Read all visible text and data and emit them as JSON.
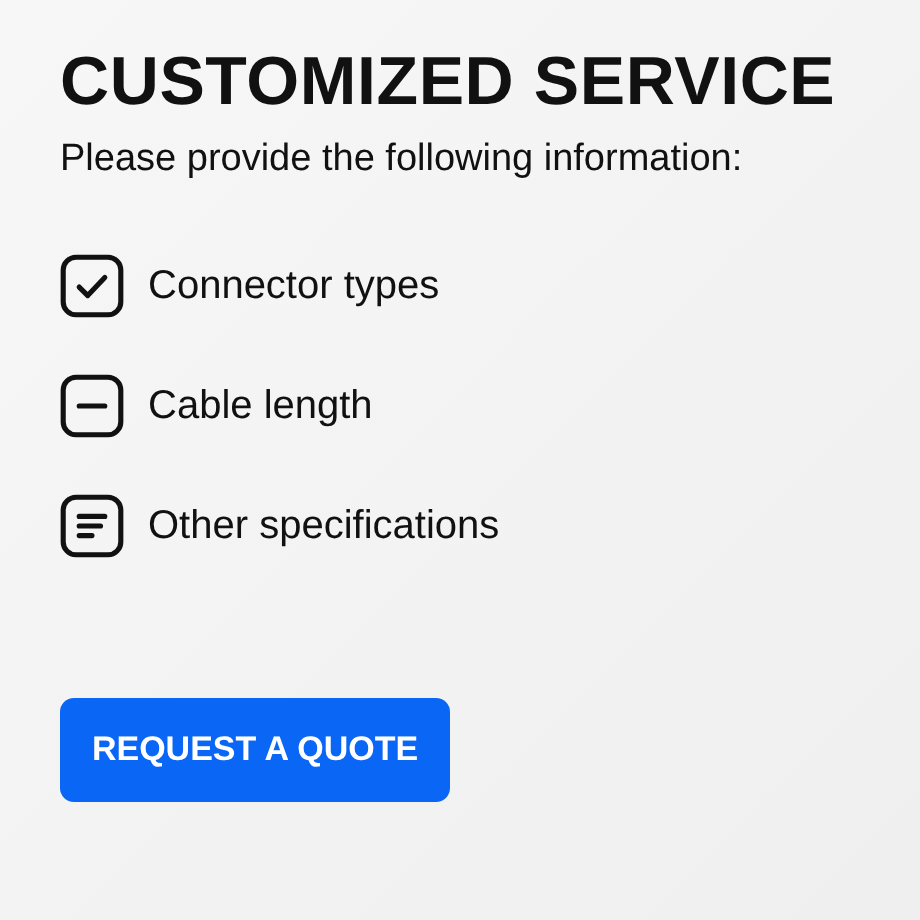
{
  "title": "CUSTOMIZED SERVICE",
  "subtitle": "Please provide the following information:",
  "items": [
    {
      "label": "Connector types"
    },
    {
      "label": "Cable length"
    },
    {
      "label": "Other specifications"
    }
  ],
  "button": "REQUEST A QUOTE"
}
